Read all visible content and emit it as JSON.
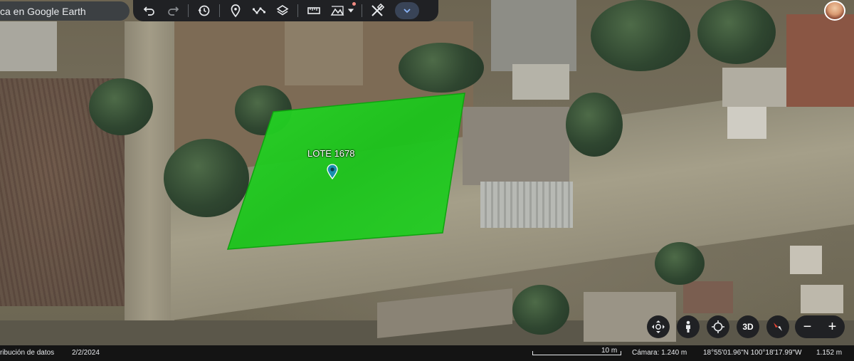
{
  "search": {
    "text": "ca en Google Earth"
  },
  "toolbar": {
    "icons": [
      "undo-icon",
      "redo-icon",
      "history-icon",
      "placemark-icon",
      "path-icon",
      "layers-icon",
      "ruler-icon",
      "map-style-icon",
      "chevron-down-icon",
      "tools-icon",
      "expand-more-icon"
    ]
  },
  "placemark": {
    "label": "LOTE 1678"
  },
  "nav": {
    "three_d_label": "3D",
    "zoom_out": "−",
    "zoom_in": "+"
  },
  "status": {
    "attribution": "ribución de datos",
    "date": "2/2/2024",
    "scale": "10 m",
    "camera": "Cámara: 1.240 m",
    "coordinates": "18°55'01.96\"N 100°18'17.99\"W",
    "elevation": "1.152 m"
  },
  "colors": {
    "lot_fill": "#1fd21f",
    "toolbar_bg": "#202124",
    "placemark_pin": "#1a8fb0"
  }
}
